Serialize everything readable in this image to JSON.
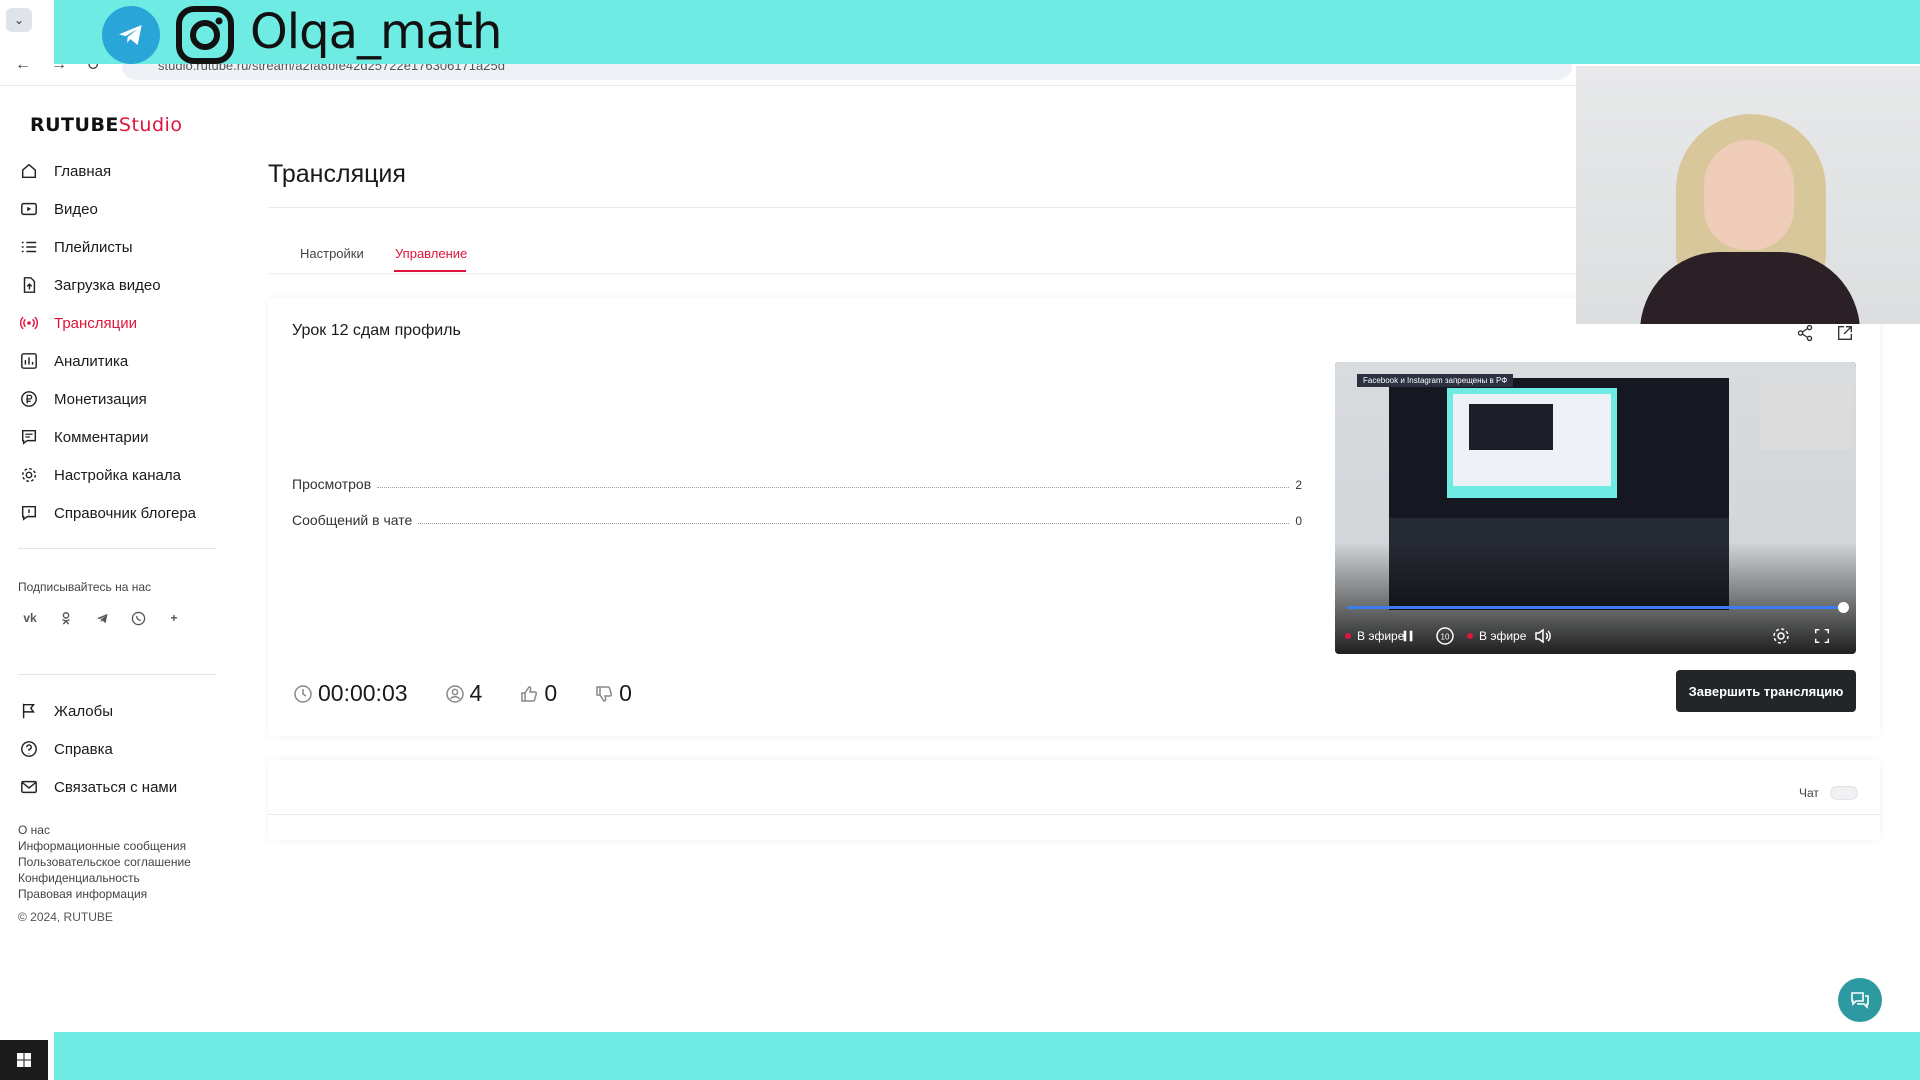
{
  "browser": {
    "url": "studio.rutube.ru/stream/a2fa8bfe42d25722e176306171a25d"
  },
  "overlay": {
    "handle": "Olqa_math"
  },
  "brand": {
    "name": "RUTUBE",
    "suffix": "Studio"
  },
  "nav": {
    "items": [
      {
        "label": "Главная",
        "icon": "home-icon"
      },
      {
        "label": "Видео",
        "icon": "video-icon"
      },
      {
        "label": "Плейлисты",
        "icon": "list-icon"
      },
      {
        "label": "Загрузка видео",
        "icon": "upload-icon"
      },
      {
        "label": "Трансляции",
        "icon": "broadcast-icon",
        "active": true
      },
      {
        "label": "Аналитика",
        "icon": "chart-icon"
      },
      {
        "label": "Монетизация",
        "icon": "ruble-icon"
      },
      {
        "label": "Комментарии",
        "icon": "comment-icon"
      },
      {
        "label": "Настройка канала",
        "icon": "gear-icon"
      },
      {
        "label": "Справочник блогера",
        "icon": "info-icon"
      }
    ],
    "subscribe_title": "Подписывайтесь на нас",
    "socials": [
      "vk-icon",
      "ok-icon",
      "telegram-icon",
      "viber-icon",
      "more-icon"
    ],
    "secondary": [
      {
        "label": "Жалобы",
        "icon": "flag-icon"
      },
      {
        "label": "Справка",
        "icon": "help-icon"
      },
      {
        "label": "Связаться с нами",
        "icon": "mail-icon"
      }
    ],
    "footer_links": [
      "О нас",
      "Информационные сообщения",
      "Пользовательское соглашение",
      "Конфиденциальность",
      "Правовая информация"
    ],
    "copyright": "© 2024, RUTUBE"
  },
  "page": {
    "title": "Трансляция",
    "tabs": [
      {
        "label": "Настройки",
        "active": false
      },
      {
        "label": "Управление",
        "active": true
      }
    ]
  },
  "stream": {
    "title": "Урок 12 сдам профиль",
    "stats": [
      {
        "label": "Просмотров",
        "value": "2"
      },
      {
        "label": "Сообщений в чате",
        "value": "0"
      }
    ],
    "player": {
      "notice": "Facebook и Instagram запрещены в РФ",
      "live_label": "В эфире",
      "live_label_2": "В эфире",
      "progress": 1.0
    },
    "metrics": {
      "duration": "00:00:03",
      "viewers": "4",
      "likes": "0",
      "dislikes": "0"
    },
    "end_button": "Завершить трансляцию"
  },
  "chat": {
    "label": "Чат",
    "enabled": false
  },
  "colors": {
    "accent": "#e1143c",
    "overlay": "#6eebe3",
    "button_dark": "#222629"
  }
}
